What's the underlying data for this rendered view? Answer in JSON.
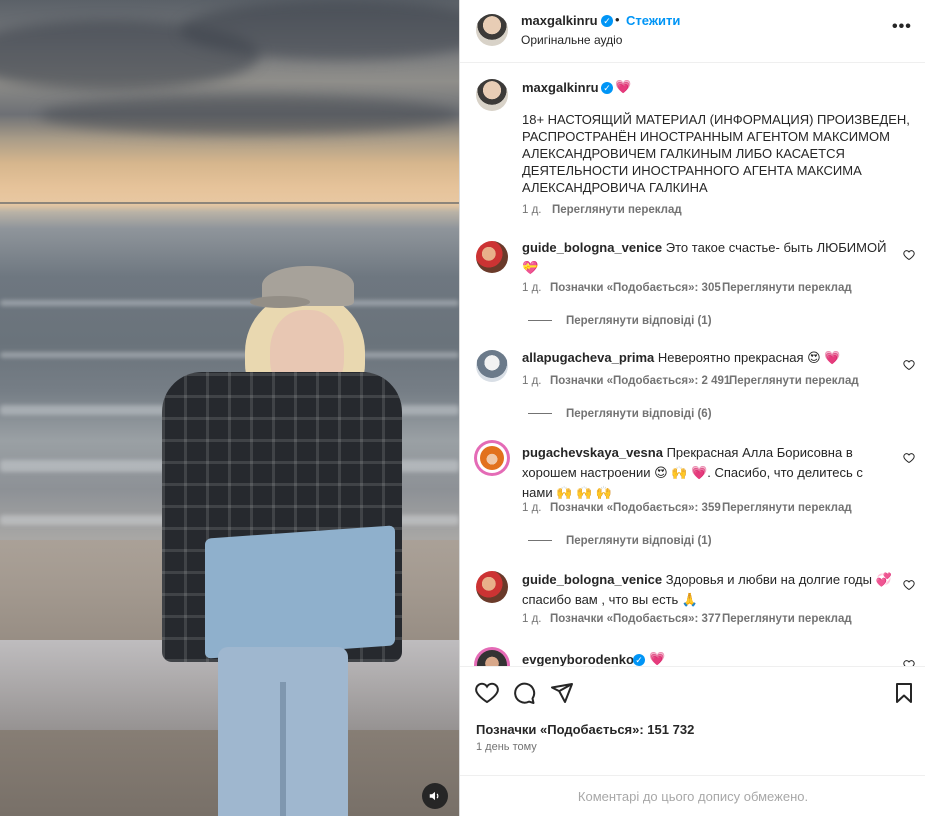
{
  "post_header": {
    "username": "maxgalkinru",
    "separator": "•",
    "follow_label": "Стежити",
    "audio_label": "Оригінальне аудіо"
  },
  "caption": {
    "username": "maxgalkinru",
    "emoji": "💗",
    "text": "18+ НАСТОЯЩИЙ МАТЕРИАЛ (ИНФОРМАЦИЯ) ПРОИЗВЕДЕН, РАСПРОСТРАНЁН ИНОСТРАННЫМ АГЕНТОМ МАКСИМОМ АЛЕКСАНДРОВИЧЕМ ГАЛКИНЫМ ЛИБО КАСАЕТСЯ ДЕЯТЕЛЬНОСТИ ИНОСТРАННОГО АГЕНТА МАКСИМА АЛЕКСАНДРОВИЧА ГАЛКИНА",
    "time": "1 д.",
    "translate_label": "Переглянути переклад"
  },
  "comments": [
    {
      "username": "guide_bologna_venice",
      "text": "Это такое счастье- быть ЛЮБИМОЙ 💝",
      "time": "1 д.",
      "likes": "Позначки «Подобається»: 305",
      "translate_label": "Переглянути переклад",
      "replies": "Переглянути відповіді (1)"
    },
    {
      "username": "allapugacheva_prima",
      "text": "Невероятно прекрасная 😍 💗",
      "time": "1 д.",
      "likes": "Позначки «Подобається»: 2 491",
      "translate_label": "Переглянути переклад",
      "replies": "Переглянути відповіді (6)"
    },
    {
      "username": "pugachevskaya_vesna",
      "text": "Прекрасная Алла Борисовна в хорошем настроении 😍 🙌 💗. Спасибо, что делитесь с нами 🙌 🙌 🙌",
      "time": "1 д.",
      "likes": "Позначки «Подобається»: 359",
      "translate_label": "Переглянути переклад",
      "replies": "Переглянути відповіді (1)"
    },
    {
      "username": "guide_bologna_venice",
      "text": "Здоровья и любви на долгие годы 💞 спасибо вам , что вы есть 🙏",
      "time": "1 д.",
      "likes": "Позначки «Подобається»: 377",
      "translate_label": "Переглянути переклад"
    },
    {
      "username": "evgenyborodenko",
      "emoji": "💗"
    }
  ],
  "actions": {
    "likes_count": "Позначки «Подобається»: 151 732",
    "time_ago": "1 день тому",
    "comments_limited": "Коментарі до цього допису обмежено."
  },
  "icons": {
    "verified": "verified-badge-icon",
    "audio": "speaker-icon",
    "more": "more-options-icon",
    "like": "heart-icon",
    "comment": "comment-icon",
    "share": "share-icon",
    "save": "bookmark-icon"
  },
  "colors": {
    "accent": "#0095f6",
    "heart": "#e0245e",
    "muted": "#737373"
  }
}
